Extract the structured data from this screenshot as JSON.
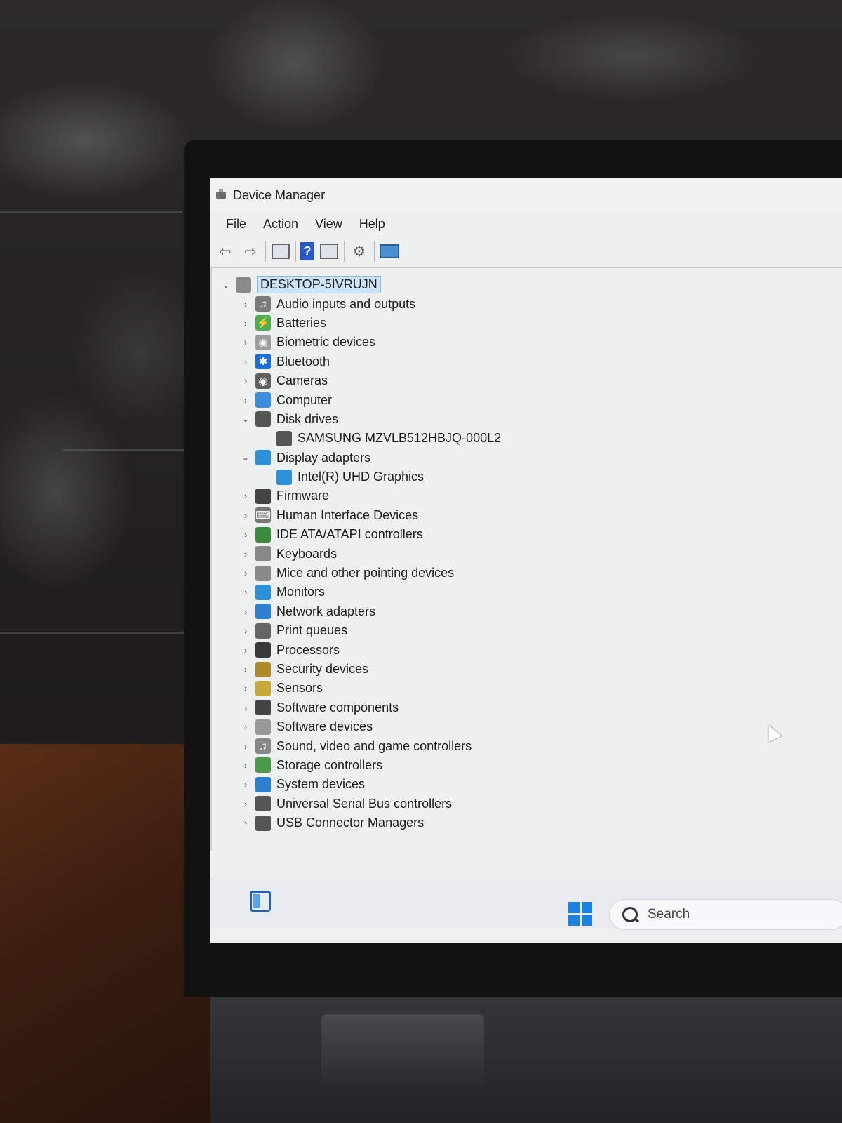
{
  "window": {
    "title": "Device Manager"
  },
  "menu": [
    "File",
    "Action",
    "View",
    "Help"
  ],
  "toolbar": {
    "icons": [
      "back-arrow-icon",
      "forward-arrow-icon",
      "properties-icon",
      "help-icon",
      "view-icon",
      "update-driver-icon",
      "scan-hardware-icon"
    ]
  },
  "tree": {
    "root": {
      "label": "DESKTOP-5IVRUJN",
      "expanded": true
    },
    "categories": [
      {
        "label": "Audio inputs and outputs",
        "icon": "speaker-icon",
        "expanded": false
      },
      {
        "label": "Batteries",
        "icon": "battery-icon",
        "expanded": false
      },
      {
        "label": "Biometric devices",
        "icon": "fingerprint-icon",
        "expanded": false
      },
      {
        "label": "Bluetooth",
        "icon": "bluetooth-icon",
        "expanded": false
      },
      {
        "label": "Cameras",
        "icon": "camera-icon",
        "expanded": false
      },
      {
        "label": "Computer",
        "icon": "computer-icon",
        "expanded": false
      },
      {
        "label": "Disk drives",
        "icon": "disk-icon",
        "expanded": true,
        "children": [
          {
            "label": "SAMSUNG MZVLB512HBJQ-000L2",
            "icon": "disk-icon"
          }
        ]
      },
      {
        "label": "Display adapters",
        "icon": "display-adapter-icon",
        "expanded": true,
        "children": [
          {
            "label": "Intel(R) UHD Graphics",
            "icon": "display-adapter-icon"
          }
        ]
      },
      {
        "label": "Firmware",
        "icon": "firmware-icon",
        "expanded": false
      },
      {
        "label": "Human Interface Devices",
        "icon": "hid-icon",
        "expanded": false
      },
      {
        "label": "IDE ATA/ATAPI controllers",
        "icon": "ide-icon",
        "expanded": false
      },
      {
        "label": "Keyboards",
        "icon": "keyboard-icon",
        "expanded": false
      },
      {
        "label": "Mice and other pointing devices",
        "icon": "mouse-icon",
        "expanded": false
      },
      {
        "label": "Monitors",
        "icon": "monitor-icon",
        "expanded": false
      },
      {
        "label": "Network adapters",
        "icon": "network-icon",
        "expanded": false
      },
      {
        "label": "Print queues",
        "icon": "printer-icon",
        "expanded": false
      },
      {
        "label": "Processors",
        "icon": "processor-icon",
        "expanded": false
      },
      {
        "label": "Security devices",
        "icon": "security-icon",
        "expanded": false
      },
      {
        "label": "Sensors",
        "icon": "sensor-icon",
        "expanded": false
      },
      {
        "label": "Software components",
        "icon": "software-component-icon",
        "expanded": false
      },
      {
        "label": "Software devices",
        "icon": "software-device-icon",
        "expanded": false
      },
      {
        "label": "Sound, video and game controllers",
        "icon": "sound-icon",
        "expanded": false
      },
      {
        "label": "Storage controllers",
        "icon": "storage-icon",
        "expanded": false
      },
      {
        "label": "System devices",
        "icon": "system-icon",
        "expanded": false
      },
      {
        "label": "Universal Serial Bus controllers",
        "icon": "usb-icon",
        "expanded": false
      },
      {
        "label": "USB Connector Managers",
        "icon": "usb-icon",
        "expanded": false
      }
    ]
  },
  "taskbar": {
    "search_placeholder": "Search"
  },
  "colors": {
    "accent": "#1a82e2",
    "selection": "#cde4f7"
  }
}
